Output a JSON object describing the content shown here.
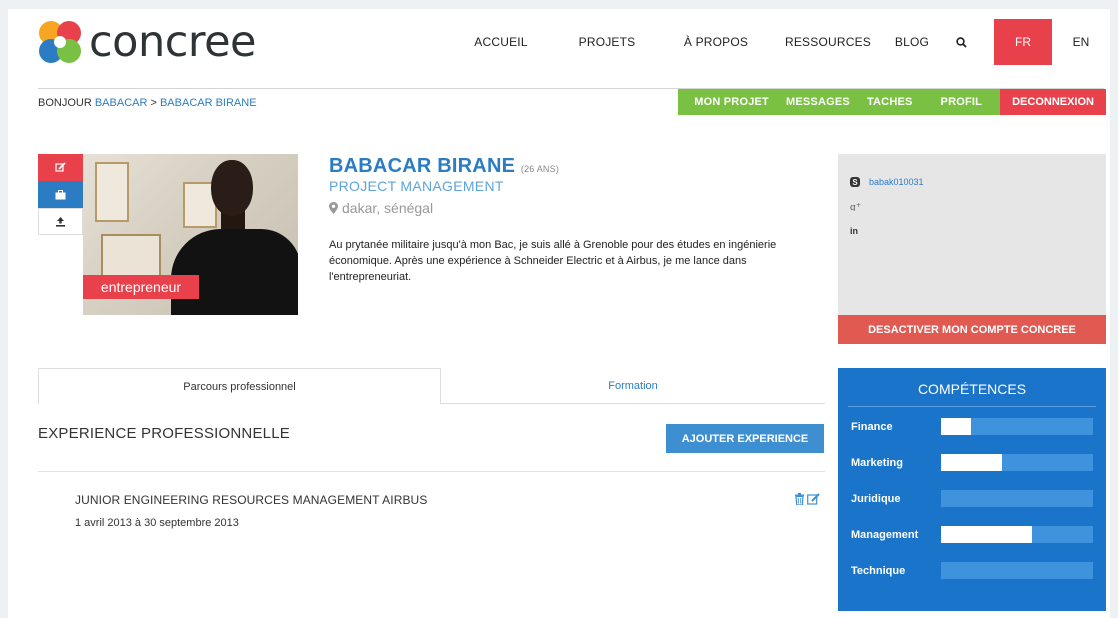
{
  "brand": {
    "logo_text": "concree"
  },
  "nav": {
    "items": [
      "ACCUEIL",
      "PROJETS",
      "À PROPOS",
      "RESSOURCES",
      "BLOG"
    ],
    "search_icon": "search-icon",
    "lang_active": "FR",
    "lang_other": "EN"
  },
  "breadcrumb": {
    "greeting": "BONJOUR ",
    "user": "BABACAR",
    "separator": " > ",
    "current": "BABACAR BIRANE"
  },
  "subnav": {
    "items": [
      "MON PROJET",
      "MESSAGES",
      "TACHES",
      "PROFIL"
    ],
    "logout": "DECONNEXION"
  },
  "profile": {
    "name": "BABACAR BIRANE",
    "age": "(26 ANS)",
    "role": "PROJECT MANAGEMENT",
    "location": "dakar, sénégal",
    "badge": "entrepreneur",
    "bio": "Au prytanée militaire jusqu'à mon Bac, je suis allé à Grenoble pour des études en ingénierie économique. Après une expérience à Schneider Electric et à Airbus, je me lance dans l'entrepreneuriat."
  },
  "social": {
    "skype": "babak010031"
  },
  "account": {
    "deactivate": "DESACTIVER MON COMPTE CONCREE"
  },
  "tabs": {
    "active": "Parcours professionnel",
    "other": "Formation"
  },
  "experience": {
    "title": "EXPERIENCE PROFESSIONNELLE",
    "add_button": "AJOUTER EXPERIENCE",
    "items": [
      {
        "title": "JUNIOR ENGINEERING RESOURCES MANAGEMENT AIRBUS",
        "dates": "1 avril 2013 à 30 septembre 2013"
      }
    ]
  },
  "skills": {
    "title": "COMPÉTENCES",
    "items": [
      {
        "label": "Finance",
        "level": 0.2
      },
      {
        "label": "Marketing",
        "level": 0.4
      },
      {
        "label": "Juridique",
        "level": 0
      },
      {
        "label": "Management",
        "level": 0.6
      },
      {
        "label": "Technique",
        "level": 0
      }
    ]
  },
  "colors": {
    "accent_red": "#e8414b",
    "accent_blue": "#2b7cc3",
    "accent_green": "#7ac143",
    "skills_bg": "#1a74c9"
  }
}
